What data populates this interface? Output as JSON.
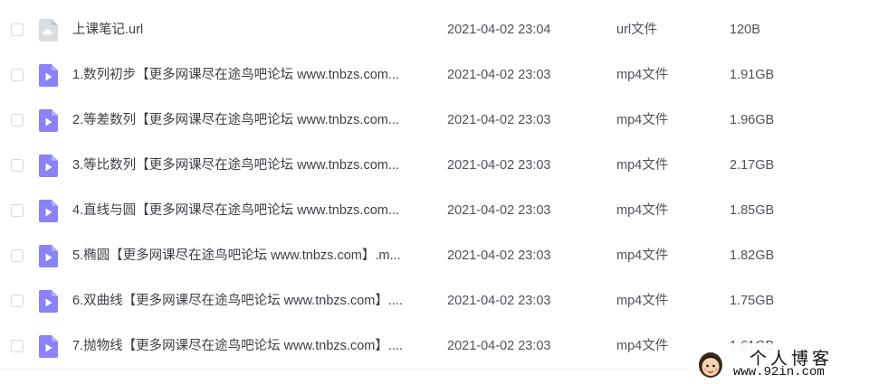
{
  "files": [
    {
      "name": "上课笔记.url",
      "date": "2021-04-02 23:04",
      "type": "url文件",
      "size": "120B",
      "icon": "url-file-icon"
    },
    {
      "name": "1.数列初步【更多网课尽在途鸟吧论坛 www.tnbzs.com...",
      "date": "2021-04-02 23:03",
      "type": "mp4文件",
      "size": "1.91GB",
      "icon": "video-file-icon"
    },
    {
      "name": "2.等差数列【更多网课尽在途鸟吧论坛 www.tnbzs.com...",
      "date": "2021-04-02 23:03",
      "type": "mp4文件",
      "size": "1.96GB",
      "icon": "video-file-icon"
    },
    {
      "name": "3.等比数列【更多网课尽在途鸟吧论坛 www.tnbzs.com...",
      "date": "2021-04-02 23:03",
      "type": "mp4文件",
      "size": "2.17GB",
      "icon": "video-file-icon"
    },
    {
      "name": "4.直线与圆【更多网课尽在途鸟吧论坛 www.tnbzs.com...",
      "date": "2021-04-02 23:03",
      "type": "mp4文件",
      "size": "1.85GB",
      "icon": "video-file-icon"
    },
    {
      "name": "5.椭圆【更多网课尽在途鸟吧论坛 www.tnbzs.com】.m...",
      "date": "2021-04-02 23:03",
      "type": "mp4文件",
      "size": "1.82GB",
      "icon": "video-file-icon"
    },
    {
      "name": "6.双曲线【更多网课尽在途鸟吧论坛 www.tnbzs.com】....",
      "date": "2021-04-02 23:03",
      "type": "mp4文件",
      "size": "1.75GB",
      "icon": "video-file-icon"
    },
    {
      "name": "7.抛物线【更多网课尽在途鸟吧论坛 www.tnbzs.com】....",
      "date": "2021-04-02 23:03",
      "type": "mp4文件",
      "size": "1.61GB",
      "icon": "video-file-icon"
    }
  ],
  "colors": {
    "video_icon": "#8a82f5",
    "url_icon": "#d9dce1",
    "text": "#3b3f45",
    "checkbox_border": "#d6d9de"
  },
  "watermark": {
    "title": "个人博客",
    "url": "www.92in.com"
  }
}
